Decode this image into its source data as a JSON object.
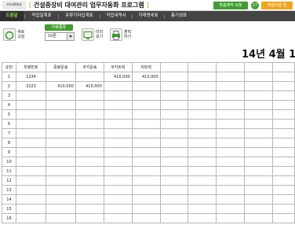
{
  "header": {
    "logo": "coukey",
    "title_bracket_open": "[",
    "title": "건설중장비 대여관리 업무자동화 프로그램",
    "title_bracket_close": "]",
    "request_button": "맞춤제작 요청",
    "count_badge": "27",
    "excel_button": "엑셀사용 팁"
  },
  "tabs": [
    {
      "label": "도움말",
      "active": true
    },
    {
      "label": "작업일계표",
      "active": false
    },
    {
      "label": "유류기타입계표",
      "active": false
    },
    {
      "label": "작업내역서",
      "active": false
    },
    {
      "label": "거래명세표",
      "active": false
    },
    {
      "label": "총기성표",
      "active": false
    }
  ],
  "toolbar": {
    "refresh_label": "새로 고침",
    "vehicle_select_label": "차량종류",
    "vehicle_select_value": "10톤",
    "preview_label": "미리 보기",
    "print_label": "출력 하기"
  },
  "date_display": "14년 4월 1",
  "table": {
    "columns": [
      "순번",
      "차량번호",
      "중량운송",
      "쿠키운송",
      "쿠키트럭",
      "뒤트럭",
      "",
      "",
      "",
      "",
      ""
    ],
    "rows": [
      [
        "1",
        "1234",
        "",
        "",
        "410,000",
        "410,000",
        "",
        "",
        "",
        "",
        ""
      ],
      [
        "2",
        "2223",
        "410,000",
        "410,000",
        "",
        "",
        "",
        "",
        "",
        "",
        ""
      ],
      [
        "3",
        "",
        "",
        "",
        "",
        "",
        "",
        "",
        "",
        "",
        ""
      ],
      [
        "4",
        "",
        "",
        "",
        "",
        "",
        "",
        "",
        "",
        "",
        ""
      ],
      [
        "5",
        "",
        "",
        "",
        "",
        "",
        "",
        "",
        "",
        "",
        ""
      ],
      [
        "6",
        "",
        "",
        "",
        "",
        "",
        "",
        "",
        "",
        "",
        ""
      ],
      [
        "7",
        "",
        "",
        "",
        "",
        "",
        "",
        "",
        "",
        "",
        ""
      ],
      [
        "8",
        "",
        "",
        "",
        "",
        "",
        "",
        "",
        "",
        "",
        ""
      ],
      [
        "9",
        "",
        "",
        "",
        "",
        "",
        "",
        "",
        "",
        "",
        ""
      ],
      [
        "10",
        "",
        "",
        "",
        "",
        "",
        "",
        "",
        "",
        "",
        ""
      ],
      [
        "11",
        "",
        "",
        "",
        "",
        "",
        "",
        "",
        "",
        "",
        ""
      ],
      [
        "12",
        "",
        "",
        "",
        "",
        "",
        "",
        "",
        "",
        "",
        ""
      ],
      [
        "13",
        "",
        "",
        "",
        "",
        "",
        "",
        "",
        "",
        "",
        ""
      ],
      [
        "14",
        "",
        "",
        "",
        "",
        "",
        "",
        "",
        "",
        "",
        ""
      ],
      [
        "15",
        "",
        "",
        "",
        "",
        "",
        "",
        "",
        "",
        "",
        ""
      ],
      [
        "16",
        "",
        "",
        "",
        "",
        "",
        "",
        "",
        "",
        "",
        ""
      ]
    ]
  },
  "colors": {
    "accent_green": "#3f9d2f",
    "accent_orange": "#f2a51d",
    "tab_bar": "#444444"
  }
}
